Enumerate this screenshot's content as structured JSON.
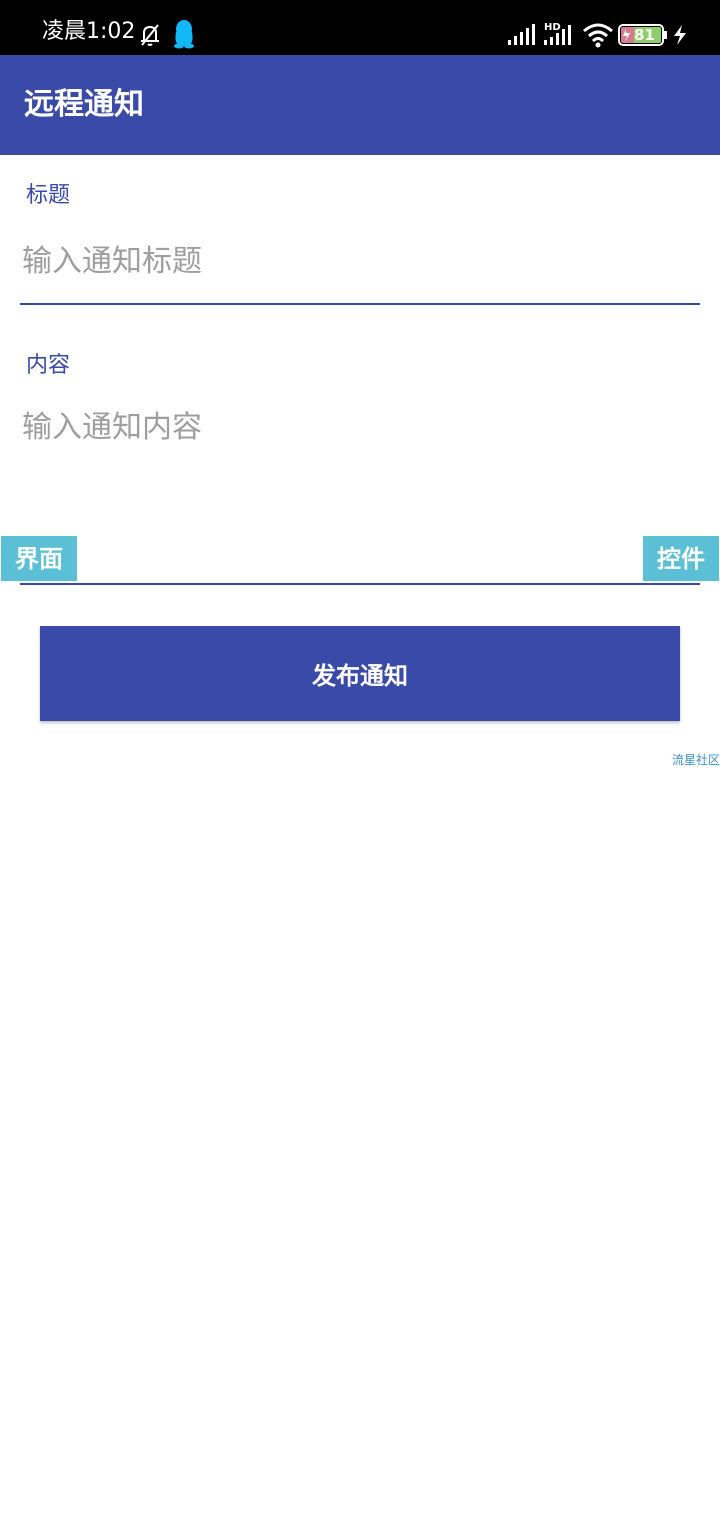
{
  "status_bar": {
    "time": "凌晨1:02",
    "battery_level": "81",
    "icons": [
      "mute-bell-icon",
      "qq-icon",
      "signal-icon",
      "hd-signal-icon",
      "wifi-icon",
      "battery-icon",
      "charging-icon"
    ]
  },
  "app_bar": {
    "title": "远程通知"
  },
  "title_field": {
    "label": "标题",
    "placeholder": "输入通知标题",
    "value": ""
  },
  "content_field": {
    "label": "内容",
    "placeholder": "输入通知内容",
    "value": ""
  },
  "side_tabs": {
    "left_label": "界面",
    "right_label": "控件"
  },
  "publish_button": {
    "label": "发布通知"
  },
  "footer": {
    "community_link": "流星社区"
  },
  "colors": {
    "primary": "#3a4aa8",
    "tab_accent": "#5bbfd6",
    "placeholder": "#9e9e9e",
    "link": "#3a8fd0",
    "qq_icon": "#12b7f5"
  }
}
